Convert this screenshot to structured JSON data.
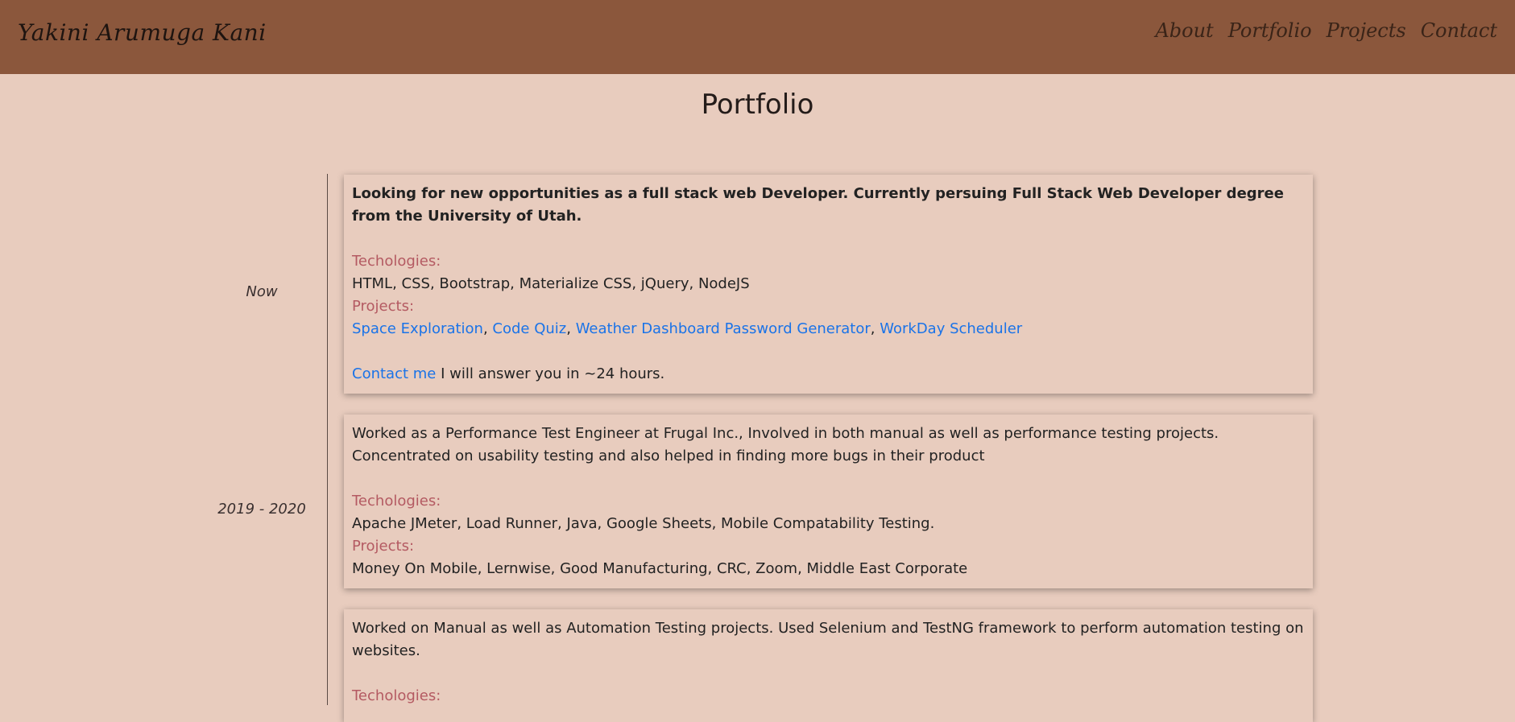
{
  "header": {
    "brand": "Yakini Arumuga Kani",
    "nav": [
      "About",
      "Portfolio",
      "Projects",
      "Contact"
    ]
  },
  "page_title": "Portfolio",
  "timeline": [
    {
      "period": "Now",
      "summary": "Looking for new opportunities as a full stack web Developer. Currently persuing Full Stack Web Developer degree from the University of Utah.",
      "tech_label": "Techologies:",
      "tech": "HTML, CSS, Bootstrap, Materialize CSS, jQuery, NodeJS",
      "projects_label": "Projects:",
      "project_links": [
        "Space Exploration",
        "Code Quiz",
        "Weather Dashboard Password Generator",
        "WorkDay Scheduler"
      ],
      "sep": ", ",
      "contact_link": "Contact me",
      "contact_text": " I will answer you in ~24 hours."
    },
    {
      "period": "2019 - 2020",
      "summary": "Worked as a Performance Test Engineer at Frugal Inc., Involved in both manual as well as performance testing projects. Concentrated on usability testing and also helped in finding more bugs in their product",
      "tech_label": "Techologies:",
      "tech": "Apache JMeter, Load Runner, Java, Google Sheets, Mobile Compatability Testing.",
      "projects_label": "Projects:",
      "projects": "Money On Mobile, Lernwise, Good Manufacturing, CRC, Zoom, Middle East Corporate"
    },
    {
      "summary": "Worked on Manual as well as Automation Testing projects. Used Selenium and TestNG framework to perform automation testing on websites.",
      "tech_label": "Techologies:"
    }
  ],
  "colors": {
    "header_bg": "#8b573c",
    "page_bg": "#e8ccbe",
    "label": "#b45a62",
    "link": "#1a73e8"
  }
}
